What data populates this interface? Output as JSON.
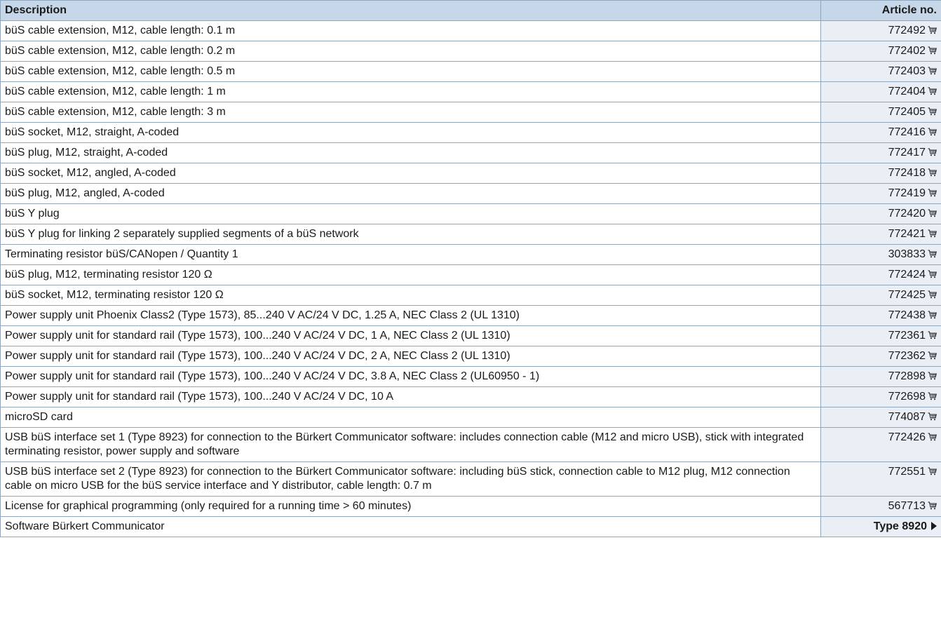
{
  "table": {
    "headers": {
      "description": "Description",
      "article": "Article no."
    },
    "rows": [
      {
        "description": "büS cable extension, M12, cable length: 0.1 m",
        "article": "772492"
      },
      {
        "description": "büS cable extension, M12, cable length: 0.2 m",
        "article": "772402"
      },
      {
        "description": "büS cable extension, M12, cable length: 0.5 m",
        "article": "772403"
      },
      {
        "description": "büS cable extension, M12, cable length: 1 m",
        "article": "772404"
      },
      {
        "description": "büS cable extension, M12, cable length: 3 m",
        "article": "772405"
      },
      {
        "description": "büS socket, M12, straight, A-coded",
        "article": "772416"
      },
      {
        "description": "büS plug, M12, straight, A-coded",
        "article": "772417"
      },
      {
        "description": "büS socket, M12, angled, A-coded",
        "article": "772418"
      },
      {
        "description": "büS plug, M12, angled, A-coded",
        "article": "772419"
      },
      {
        "description": "büS Y plug",
        "article": "772420"
      },
      {
        "description": "büS Y plug for linking 2 separately supplied segments of a büS network",
        "article": "772421"
      },
      {
        "description": "Terminating resistor büS/CANopen / Quantity 1",
        "article": "303833"
      },
      {
        "description": "büS plug, M12, terminating resistor 120 Ω",
        "article": "772424"
      },
      {
        "description": "büS socket, M12, terminating resistor 120 Ω",
        "article": "772425"
      },
      {
        "description": "Power supply unit Phoenix Class2 (Type 1573), 85...240 V AC/24 V DC, 1.25 A, NEC Class 2 (UL 1310)",
        "article": "772438"
      },
      {
        "description": "Power supply unit for standard rail (Type 1573), 100...240 V AC/24 V DC, 1 A, NEC Class 2 (UL 1310)",
        "article": "772361"
      },
      {
        "description": "Power supply unit for standard rail (Type 1573), 100...240 V AC/24 V DC, 2 A, NEC Class 2 (UL 1310)",
        "article": "772362"
      },
      {
        "description": "Power supply unit for standard rail (Type 1573), 100...240 V AC/24 V DC, 3.8 A, NEC Class 2 (UL60950 - 1)",
        "article": "772898"
      },
      {
        "description": "Power supply unit for standard rail (Type 1573), 100...240 V AC/24 V DC, 10 A",
        "article": "772698"
      },
      {
        "description": "microSD card",
        "article": "774087"
      },
      {
        "description": "USB büS interface set 1 (Type 8923) for connection to the Bürkert Communicator software: includes connection cable (M12 and micro USB), stick with integrated terminating resistor, power supply and software",
        "article": "772426"
      },
      {
        "description": "USB büS interface set 2 (Type 8923) for connection to the Bürkert Communicator software: including büS stick, connection cable to M12 plug, M12 connection cable on micro USB for the büS service interface and Y distributor, cable length: 0.7 m",
        "article": "772551"
      },
      {
        "description": "License for graphical programming (only required for a running time > 60 minutes)",
        "article": "567713"
      }
    ],
    "last_row": {
      "description": "Software Bürkert Communicator",
      "link_label": "Type 8920"
    }
  },
  "icons": {
    "cart": "shopping-cart-icon",
    "link_arrow": "triangle-right-icon"
  },
  "colors": {
    "header_bg": "#c5d7e8",
    "article_cell_bg": "#e9eff5",
    "border": "#8fa6bb"
  }
}
